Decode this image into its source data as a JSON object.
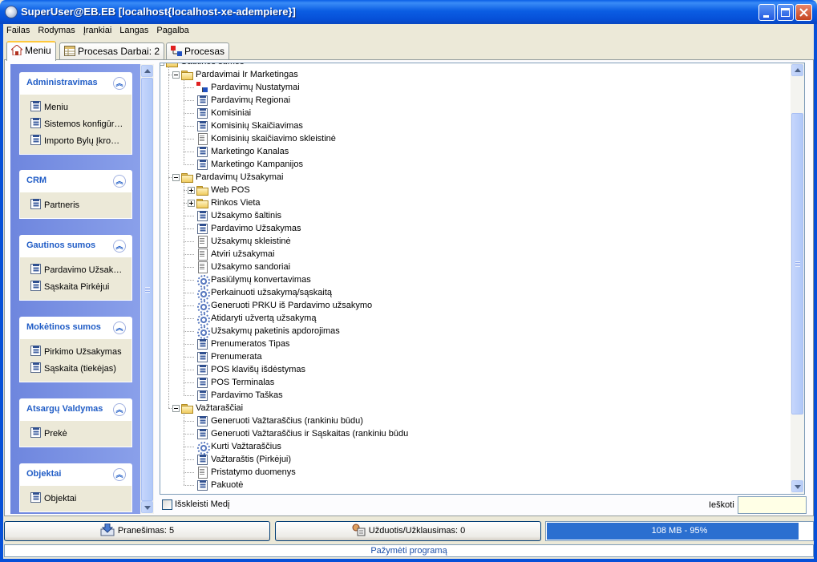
{
  "window": {
    "title": "SuperUser@EB.EB [localhost{localhost-xe-adempiere}]"
  },
  "menubar": [
    "Failas",
    "Rodymas",
    "Įrankiai",
    "Langas",
    "Pagalba"
  ],
  "tabs": [
    {
      "label": "Meniu"
    },
    {
      "label": "Procesas  Darbai: 2"
    },
    {
      "label": "Procesas"
    }
  ],
  "sidebar": {
    "groups": [
      {
        "title": "Administravimas",
        "items": [
          "Meniu",
          "Sistemos konfigūr…",
          "Importo Bylų Įkro…"
        ]
      },
      {
        "title": "CRM",
        "items": [
          "Partneris"
        ]
      },
      {
        "title": "Gautinos sumos",
        "items": [
          "Pardavimo Užsak…",
          "Sąskaita Pirkėjui"
        ]
      },
      {
        "title": "Mokėtinos sumos",
        "items": [
          "Pirkimo Užsakymas",
          "Sąskaita (tiekėjas)"
        ]
      },
      {
        "title": "Atsargų Valdymas",
        "items": [
          "Prekė"
        ]
      },
      {
        "title": "Objektai",
        "items": [
          "Objektai"
        ]
      }
    ]
  },
  "tree": {
    "nodes": [
      {
        "label": "Gautinos sumos",
        "icon": "folder-icon",
        "level": 0,
        "expander": "minus"
      },
      {
        "label": "Pardavimai Ir Marketingas",
        "icon": "folder-icon",
        "level": 1,
        "expander": "minus"
      },
      {
        "label": "Pardavimų Nustatymai",
        "icon": "workflow-icon",
        "level": 2
      },
      {
        "label": "Pardavimų Regionai",
        "icon": "window-icon",
        "level": 2
      },
      {
        "label": "Komisiniai",
        "icon": "window-icon",
        "level": 2
      },
      {
        "label": "Komisinių Skaičiavimas",
        "icon": "window-icon",
        "level": 2
      },
      {
        "label": "Komisinių skaičiavimo skleistinė",
        "icon": "report-icon",
        "level": 2
      },
      {
        "label": "Marketingo Kanalas",
        "icon": "window-icon",
        "level": 2
      },
      {
        "label": "Marketingo Kampanijos",
        "icon": "window-icon",
        "level": 2
      },
      {
        "label": "Pardavimų Užsakymai",
        "icon": "folder-icon",
        "level": 1,
        "expander": "minus"
      },
      {
        "label": "Web POS",
        "icon": "folder-icon",
        "level": 2,
        "expander": "plus"
      },
      {
        "label": "Rinkos Vieta",
        "icon": "folder-icon",
        "level": 2,
        "expander": "plus"
      },
      {
        "label": "Užsakymo šaltinis",
        "icon": "window-icon",
        "level": 2
      },
      {
        "label": "Pardavimo Užsakymas",
        "icon": "window-icon",
        "level": 2
      },
      {
        "label": "Užsakymų skleistinė",
        "icon": "report-icon",
        "level": 2
      },
      {
        "label": "Atviri užsakymai",
        "icon": "report-icon",
        "level": 2
      },
      {
        "label": "Užsakymo sandoriai",
        "icon": "report-icon",
        "level": 2
      },
      {
        "label": "Pasiūlymų konvertavimas",
        "icon": "process-icon",
        "level": 2
      },
      {
        "label": "Perkainuoti užsakymą/sąskaitą",
        "icon": "process-icon",
        "level": 2
      },
      {
        "label": "Generuoti PRKU iš Pardavimo užsakymo",
        "icon": "process-icon",
        "level": 2
      },
      {
        "label": "Atidaryti užvertą užsakymą",
        "icon": "process-icon",
        "level": 2
      },
      {
        "label": "Užsakymų paketinis apdorojimas",
        "icon": "process-icon",
        "level": 2
      },
      {
        "label": "Prenumeratos Tipas",
        "icon": "window-icon",
        "level": 2
      },
      {
        "label": "Prenumerata",
        "icon": "window-icon",
        "level": 2
      },
      {
        "label": "POS klavišų išdėstymas",
        "icon": "window-icon",
        "level": 2
      },
      {
        "label": "POS Terminalas",
        "icon": "window-icon",
        "level": 2
      },
      {
        "label": "Pardavimo Taškas",
        "icon": "window-icon",
        "level": 2
      },
      {
        "label": "Važtaraščiai",
        "icon": "folder-icon",
        "level": 1,
        "expander": "minus"
      },
      {
        "label": "Generuoti Važtaraščius (rankiniu būdu)",
        "icon": "window-icon",
        "level": 2
      },
      {
        "label": "Generuoti Važtaraščius ir Sąskaitas (rankiniu būdu",
        "icon": "window-icon",
        "level": 2
      },
      {
        "label": "Kurti Važtaraščius",
        "icon": "process-icon",
        "level": 2
      },
      {
        "label": "Važtaraštis (Pirkėjui)",
        "icon": "window-icon",
        "level": 2
      },
      {
        "label": "Pristatymo duomenys",
        "icon": "report-icon",
        "level": 2
      },
      {
        "label": "Pakuotė",
        "icon": "window-icon",
        "level": 2
      }
    ]
  },
  "bottom": {
    "expand_tree_label": "Išskleisti Medį",
    "expand_tree_checked": false,
    "search_label": "Ieškoti",
    "search_value": ""
  },
  "status": {
    "notices_label": "Pranešimas: 5",
    "tasks_label": "Užduotis/Užklausimas: 0",
    "memory_label": "108 MB - 95%",
    "memory_fraction": 0.95,
    "hint": "Pažymėti programą"
  },
  "colors": {
    "title_bar": "#0b5ee3",
    "sidebar_header_text": "#215dc6",
    "memory_bar": "#2b6fd0",
    "hint_text": "#1a4ea8"
  }
}
